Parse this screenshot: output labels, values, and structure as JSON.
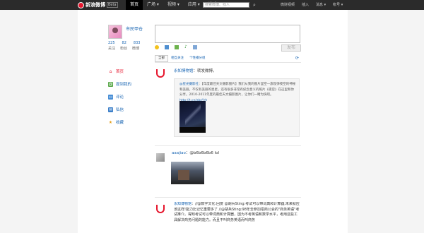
{
  "topbar": {
    "logo_text": "新浪微博",
    "logo_badge": "Beta",
    "nav": [
      "首页",
      "广场 ▾",
      "视频 ▾",
      "应用 ▾",
      "游戏 ▾"
    ],
    "search_placeholder": "搜索微博、找人",
    "right_links": [
      "微财视频",
      "插入",
      "消息 ▾",
      "帐号 ▾"
    ]
  },
  "profile": {
    "username": "市民甲仓",
    "stats": [
      "225",
      "82",
      "833"
    ],
    "stat_labels": [
      "关注",
      "粉丝",
      "微博"
    ]
  },
  "sidebar": {
    "items": [
      {
        "label": "首页",
        "icon": "home-icon"
      },
      {
        "label": "提到我的",
        "icon": "at-icon"
      },
      {
        "label": "评论",
        "icon": "comment-icon"
      },
      {
        "label": "私信",
        "icon": "message-icon"
      },
      {
        "label": "收藏",
        "icon": "star-icon"
      }
    ]
  },
  "composer": {
    "post_label": "发布"
  },
  "feed_tabs": {
    "tabs": [
      "全部",
      "相互关注",
      "个性播分组"
    ],
    "refresh": "⟳"
  },
  "feed": [
    {
      "author": "永知博物馆",
      "text": "转发微博。",
      "quote_author": "@星光摄影社",
      "quote_text": "【年度最佳天文摄影图片】我们从我的图片里空一旅现弹夜空的神秘和美丽。不仅有美丽的星星，还有很多非常有纪念意义的照片《夜空》在这里和你分享。2010-2011年度的最佳天文摄影图片，让你们一睹为快吧。",
      "quote_link": "http://t.cn/abzYrh"
    },
    {
      "author": "aaajiao",
      "text": "@b6b6b6b6 lol"
    },
    {
      "author": "永知博物馆",
      "text": "//@数字文化:回复 @胡兵Sting:考试可以带词典和计算器;未来就应该这样!能力比记忆重要多了 //@胡兵Sting:98年去参加招商公会的\"商务英语\"考试推介。得知考试可以带词典和计算器，因为不考英语和数学水平，考用这些工具解决商务问题的能力。而且不叫商务英语而叫商务"
    }
  ],
  "colors": {
    "brand_red": "#e6162d",
    "link_blue": "#1a66b3",
    "topbar_bg": "#2b2b2b"
  }
}
